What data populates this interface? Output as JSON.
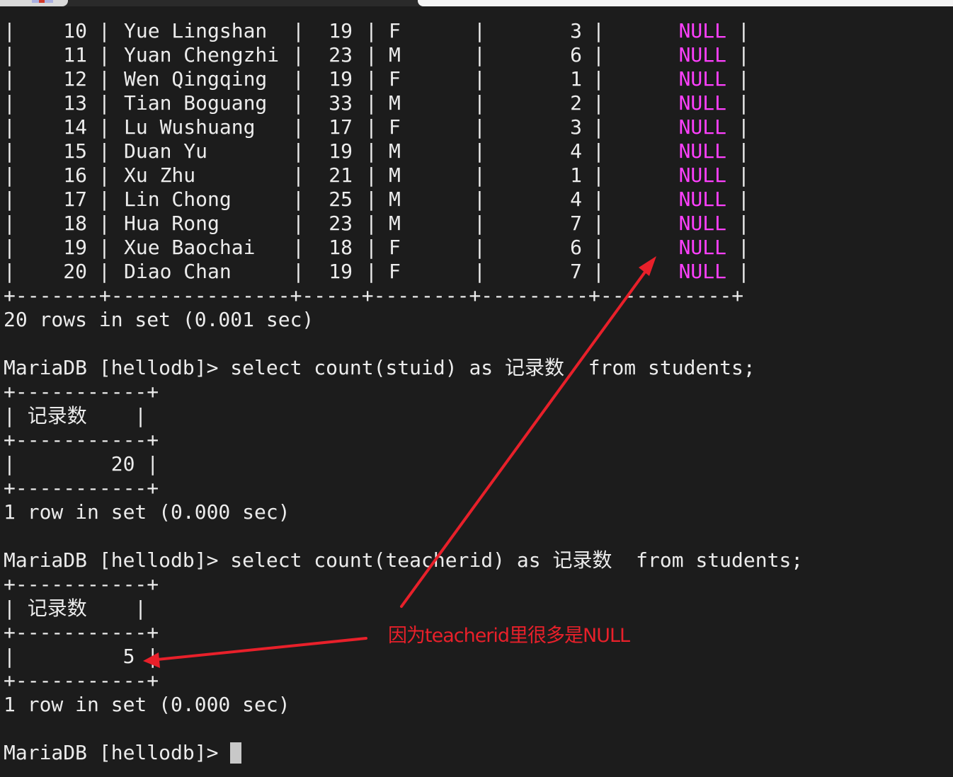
{
  "table_rows": [
    {
      "id": "10",
      "name": "Yue Lingshan",
      "age": "19",
      "gender": "F",
      "classid": "3",
      "teacherid": "NULL"
    },
    {
      "id": "11",
      "name": "Yuan Chengzhi",
      "age": "23",
      "gender": "M",
      "classid": "6",
      "teacherid": "NULL"
    },
    {
      "id": "12",
      "name": "Wen Qingqing",
      "age": "19",
      "gender": "F",
      "classid": "1",
      "teacherid": "NULL"
    },
    {
      "id": "13",
      "name": "Tian Boguang",
      "age": "33",
      "gender": "M",
      "classid": "2",
      "teacherid": "NULL"
    },
    {
      "id": "14",
      "name": "Lu Wushuang",
      "age": "17",
      "gender": "F",
      "classid": "3",
      "teacherid": "NULL"
    },
    {
      "id": "15",
      "name": "Duan Yu",
      "age": "19",
      "gender": "M",
      "classid": "4",
      "teacherid": "NULL"
    },
    {
      "id": "16",
      "name": "Xu Zhu",
      "age": "21",
      "gender": "M",
      "classid": "1",
      "teacherid": "NULL"
    },
    {
      "id": "17",
      "name": "Lin Chong",
      "age": "25",
      "gender": "M",
      "classid": "4",
      "teacherid": "NULL"
    },
    {
      "id": "18",
      "name": "Hua Rong",
      "age": "23",
      "gender": "M",
      "classid": "7",
      "teacherid": "NULL"
    },
    {
      "id": "19",
      "name": "Xue Baochai",
      "age": "18",
      "gender": "F",
      "classid": "6",
      "teacherid": "NULL"
    },
    {
      "id": "20",
      "name": "Diao Chan",
      "age": "19",
      "gender": "F",
      "classid": "7",
      "teacherid": "NULL"
    }
  ],
  "table_border": "+-------+---------------+-----+--------+---------+-----------+",
  "result1_status": "20 rows in set (0.001 sec)",
  "query1": "MariaDB [hellodb]> select count(stuid) as 记录数  from students;",
  "small_border": "+-----------+",
  "small_header": "| 记录数    |",
  "query1_value_line": "|        20 |",
  "query1_status": "1 row in set (0.000 sec)",
  "query2": "MariaDB [hellodb]> select count(teacherid) as 记录数  from students;",
  "query2_value_line": "|         5 |",
  "query2_status": "1 row in set (0.000 sec)",
  "prompt": "MariaDB [hellodb]> ",
  "annotation": "因为teacherid里很多是NULL",
  "colors": {
    "background": "#1c1c1c",
    "text": "#ececec",
    "null": "#ff40ff",
    "annotation": "#e8202a"
  }
}
